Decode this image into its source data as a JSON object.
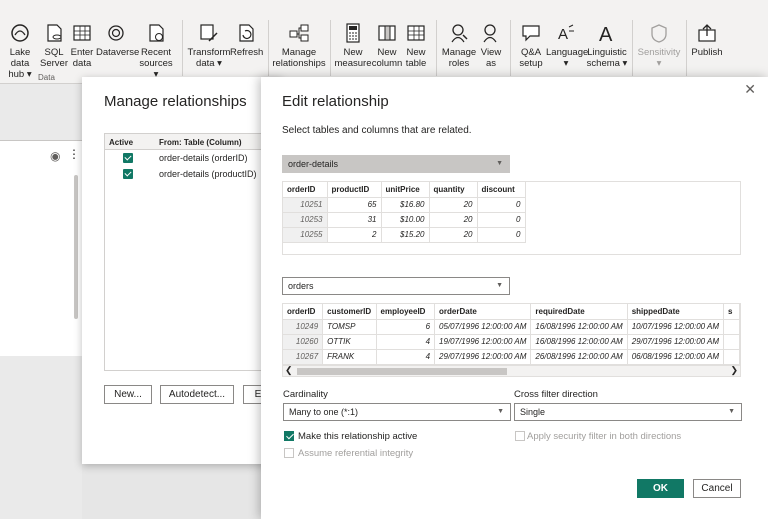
{
  "ribbon": {
    "items": [
      {
        "name": "onelake",
        "l1": "Lake data",
        "l2": "hub ▾"
      },
      {
        "name": "sql",
        "l1": "SQL",
        "l2": "Server"
      },
      {
        "name": "enter",
        "l1": "Enter",
        "l2": "data"
      },
      {
        "name": "dataverse",
        "l1": "Dataverse",
        "l2": ""
      },
      {
        "name": "recent",
        "l1": "Recent",
        "l2": "sources ▾"
      },
      {
        "name": "transform",
        "l1": "Transform",
        "l2": "data ▾"
      },
      {
        "name": "refresh",
        "l1": "Refresh",
        "l2": ""
      },
      {
        "name": "manage-rel",
        "l1": "Manage",
        "l2": "relationships"
      },
      {
        "name": "new-measure",
        "l1": "New",
        "l2": "measure"
      },
      {
        "name": "new-column",
        "l1": "New",
        "l2": "column"
      },
      {
        "name": "new-table",
        "l1": "New",
        "l2": "table"
      },
      {
        "name": "manage-roles",
        "l1": "Manage",
        "l2": "roles"
      },
      {
        "name": "view-as",
        "l1": "View",
        "l2": "as"
      },
      {
        "name": "qa",
        "l1": "Q&A",
        "l2": "setup"
      },
      {
        "name": "language",
        "l1": "Language",
        "l2": "▾"
      },
      {
        "name": "linguistic",
        "l1": "Linguistic",
        "l2": "schema ▾"
      },
      {
        "name": "sensitivity",
        "l1": "Sensitivity",
        "l2": "▾"
      },
      {
        "name": "publish",
        "l1": "Publish",
        "l2": ""
      }
    ],
    "group_data_label": "Data"
  },
  "manage": {
    "title": "Manage relationships",
    "col_active": "Active",
    "col_from": "From: Table (Column)",
    "rows": [
      "order-details (orderID)",
      "order-details (productID)"
    ],
    "btn_new": "New...",
    "btn_autodetect": "Autodetect...",
    "btn_edit": "E"
  },
  "edit": {
    "title": "Edit relationship",
    "subtitle": "Select tables and columns that are related.",
    "table1": "order-details",
    "t1_headers": [
      "orderID",
      "productID",
      "unitPrice",
      "quantity",
      "discount"
    ],
    "t1_rows": [
      [
        "10251",
        "65",
        "$16.80",
        "20",
        "0"
      ],
      [
        "10253",
        "31",
        "$10.00",
        "20",
        "0"
      ],
      [
        "10255",
        "2",
        "$15.20",
        "20",
        "0"
      ]
    ],
    "table2": "orders",
    "t2_headers": [
      "orderID",
      "customerID",
      "employeeID",
      "orderDate",
      "requiredDate",
      "shippedDate",
      "s"
    ],
    "t2_rows": [
      [
        "10249",
        "TOMSP",
        "6",
        "05/07/1996 12:00:00 AM",
        "16/08/1996 12:00:00 AM",
        "10/07/1996 12:00:00 AM",
        ""
      ],
      [
        "10260",
        "OTTIK",
        "4",
        "19/07/1996 12:00:00 AM",
        "16/08/1996 12:00:00 AM",
        "29/07/1996 12:00:00 AM",
        ""
      ],
      [
        "10267",
        "FRANK",
        "4",
        "29/07/1996 12:00:00 AM",
        "26/08/1996 12:00:00 AM",
        "06/08/1996 12:00:00 AM",
        ""
      ]
    ],
    "cardinality_label": "Cardinality",
    "cardinality_value": "Many to one (*:1)",
    "crossfilter_label": "Cross filter direction",
    "crossfilter_value": "Single",
    "make_active": "Make this relationship active",
    "referential": "Assume referential integrity",
    "security": "Apply security filter in both directions",
    "ok": "OK",
    "cancel": "Cancel"
  },
  "colors": {
    "accent": "#117865",
    "ribbon_bg": "#f3f2f1"
  }
}
